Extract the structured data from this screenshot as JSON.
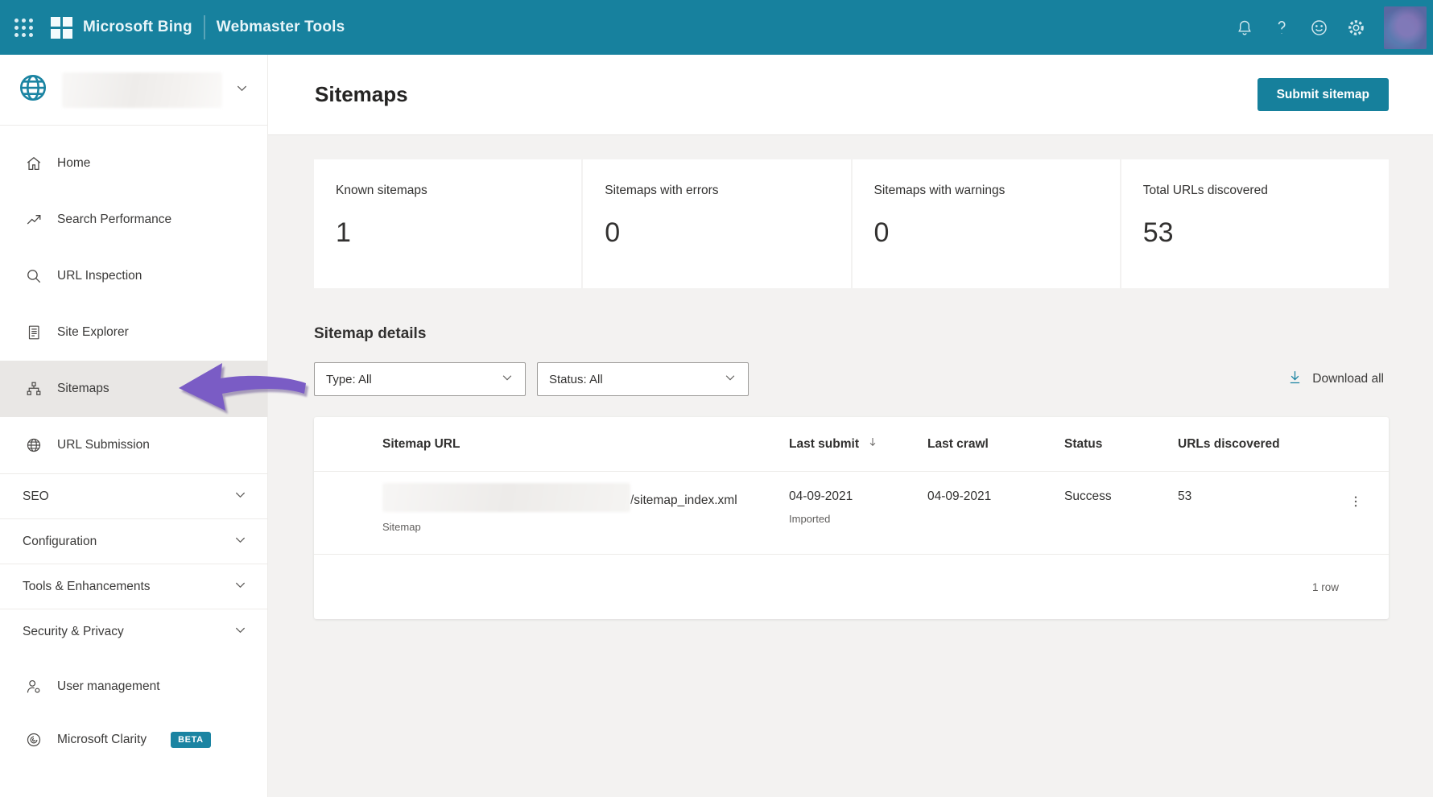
{
  "colors": {
    "topbar_teal": "#17819e",
    "accent_teal": "#1b84a2",
    "button_teal": "#16809c",
    "arrow_purple": "#7a5cc5",
    "active_item_bg": "#e9e7e5",
    "page_bg": "#f3f2f1"
  },
  "topbar": {
    "brand": "Microsoft Bing",
    "product": "Webmaster Tools"
  },
  "sidebar": {
    "items": [
      {
        "label": "Home"
      },
      {
        "label": "Search Performance"
      },
      {
        "label": "URL Inspection"
      },
      {
        "label": "Site Explorer"
      },
      {
        "label": "Sitemaps",
        "active": true
      },
      {
        "label": "URL Submission"
      }
    ],
    "groups": [
      {
        "label": "SEO"
      },
      {
        "label": "Configuration"
      },
      {
        "label": "Tools & Enhancements"
      },
      {
        "label": "Security & Privacy"
      }
    ],
    "footer": [
      {
        "label": "User management"
      },
      {
        "label": "Microsoft Clarity",
        "badge": "BETA"
      }
    ]
  },
  "page": {
    "title": "Sitemaps",
    "submit_button": "Submit sitemap"
  },
  "stats": [
    {
      "label": "Known sitemaps",
      "value": "1"
    },
    {
      "label": "Sitemaps with errors",
      "value": "0"
    },
    {
      "label": "Sitemaps with warnings",
      "value": "0"
    },
    {
      "label": "Total URLs discovered",
      "value": "53"
    }
  ],
  "details": {
    "heading": "Sitemap details",
    "filters": [
      {
        "label": "Type: All"
      },
      {
        "label": "Status: All"
      }
    ],
    "download_all": "Download all"
  },
  "table": {
    "columns": [
      "Sitemap URL",
      "Last submit",
      "Last crawl",
      "Status",
      "URLs discovered"
    ],
    "rows": [
      {
        "url_suffix": "/sitemap_index.xml",
        "url_type": "Sitemap",
        "last_submit": "04-09-2021",
        "last_submit_note": "Imported",
        "last_crawl": "04-09-2021",
        "status": "Success",
        "urls_discovered": "53"
      }
    ],
    "footer": "1 row"
  }
}
